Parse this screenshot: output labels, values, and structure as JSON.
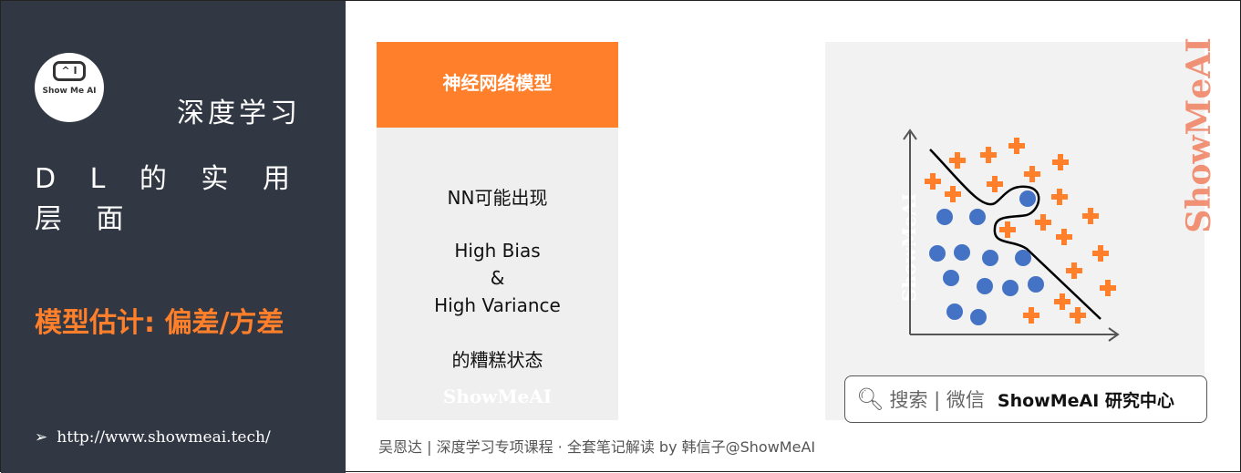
{
  "sidebar": {
    "logo_text": "Show Me AI",
    "logo_screen": "^ I",
    "course": "深度学习",
    "chapter": "D L 的 实 用 层 面",
    "topic": "模型估计: 偏差/方差",
    "url": "http://www.showmeai.tech/"
  },
  "card": {
    "header": "神经网络模型",
    "line1": "NN可能出现",
    "line2": "High Bias",
    "line3": "&",
    "line4": "High Variance",
    "line5": "的糟糕状态",
    "watermark": "ShowMeAI"
  },
  "plot": {
    "watermark": "ShowMeAI",
    "colors": {
      "circle": "#4472c4",
      "plus": "#ff7f2a"
    }
  },
  "brand_side": "ShowMeAI",
  "search": {
    "label": "搜索 | 微信",
    "brand": "ShowMeAI 研究中心"
  },
  "footer": "吴恩达 | 深度学习专项课程 · 全套笔记解读  by 韩信子@ShowMeAI"
}
